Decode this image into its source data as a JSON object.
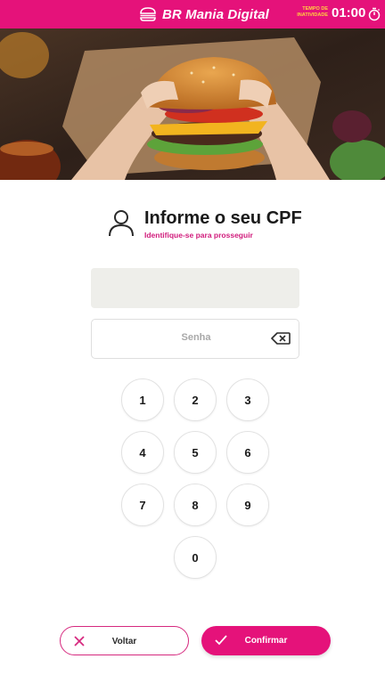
{
  "header": {
    "brand_title": "BR Mania Digital",
    "inactivity_label_line1": "TEMPO DE",
    "inactivity_label_line2": "INATIVIDADE",
    "timer": "01:00",
    "brand_icon": "burger-icon",
    "timer_icon": "stopwatch-icon"
  },
  "hero": {
    "image": "burger-photo"
  },
  "login": {
    "title": "Informe o seu CPF",
    "subtitle": "Identifique-se para prosseguir",
    "cpf_value": "",
    "password_placeholder": "Senha"
  },
  "keypad": {
    "keys": [
      "1",
      "2",
      "3",
      "4",
      "5",
      "6",
      "7",
      "8",
      "9",
      "0"
    ]
  },
  "actions": {
    "back_label": "Voltar",
    "confirm_label": "Confirmar"
  },
  "colors": {
    "brand": "#e5127a",
    "accent_text": "#d11c7c",
    "timer_label": "#ffd23f"
  }
}
